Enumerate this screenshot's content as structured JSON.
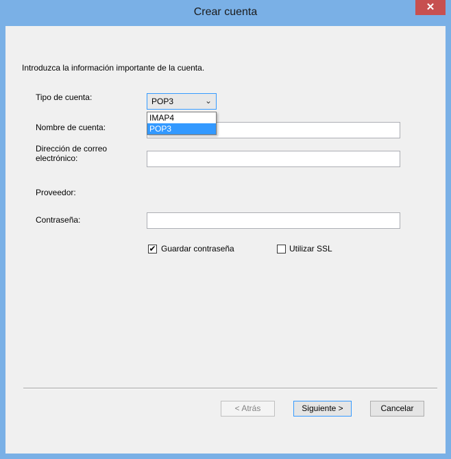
{
  "window": {
    "title": "Crear cuenta",
    "close_label": "✕"
  },
  "intro": "Introduzca la información importante de la cuenta.",
  "form": {
    "account_type_label": "Tipo de cuenta:",
    "account_type_value": "POP3",
    "account_type_options": [
      "IMAP4",
      "POP3"
    ],
    "account_type_highlighted": "POP3",
    "account_name_label": "Nombre de cuenta:",
    "account_name_value": "",
    "email_label_line1": "Dirección de correo",
    "email_label_line2": "electrónico:",
    "email_value": "",
    "provider_label": "Proveedor:",
    "password_label": "Contraseña:",
    "password_value": "",
    "save_password_label": "Guardar contraseña",
    "save_password_checked": true,
    "use_ssl_label": "Utilizar SSL",
    "use_ssl_checked": false
  },
  "buttons": {
    "back": "< Atrás",
    "next": "Siguiente >",
    "cancel": "Cancelar"
  },
  "colors": {
    "titlebar": "#7ab0e6",
    "close_button": "#c75050",
    "selection": "#3399ff"
  }
}
